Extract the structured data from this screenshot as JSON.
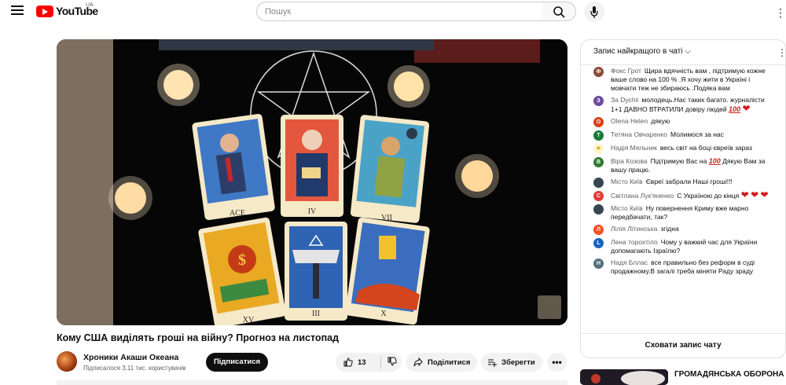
{
  "header": {
    "brand": "YouTube",
    "region": "UA",
    "search_placeholder": "Пошук"
  },
  "video": {
    "title": "Кому США виділять гроші на війну? Прогноз на листопад",
    "tarot_cards": [
      "ACE",
      "IV",
      "VII",
      "XV",
      "III",
      "X"
    ]
  },
  "channel": {
    "name": "Хроники Акаши Океана",
    "subscribers": "Підписалося 3,11 тис. користувачів",
    "subscribe_label": "Підписатися"
  },
  "actions": {
    "likes": "13",
    "share_label": "Поділитися",
    "save_label": "Зберегти"
  },
  "chat": {
    "header_label": "Запис найкращого в чаті",
    "hide_label": "Сховати запис чату",
    "messages": [
      {
        "author": "Фокс Грот",
        "text": "Щира вдячність вам , підтримую кожне ваше слово на 100 % .Я хочу жити в Україні і мовчати теж не збираюсь .Подяка вам",
        "avatar_letter": "Ф",
        "avatar_color": "#8d4d3a"
      },
      {
        "author": "За Dychii",
        "text": "молодець.Нас таких багато. журналісти 1+1 ДАВНО ВТРАТИЛИ довіру людей",
        "avatar_letter": "З",
        "avatar_color": "#6d4ca0"
      },
      {
        "author": "Olena Helen",
        "text": "дякую",
        "avatar_letter": "O",
        "avatar_color": "#d84315"
      },
      {
        "author": "Тетяна Овчаренко",
        "text": "Молимося за нас",
        "avatar_letter": "Т",
        "avatar_color": "#1b7a3a"
      },
      {
        "author": "Надія Мельник",
        "text": "весь світ на боці євреїв зараз",
        "avatar_letter": "Н",
        "avatar_color": "#f2b300"
      },
      {
        "author": "Віра Козова",
        "text": "Підтримую Вас на",
        "text_after": "Дякую Вам за вашу працю.",
        "avatar_letter": "В",
        "avatar_color": "#2e7d32"
      },
      {
        "author": "Місто Київ",
        "text": "Євреї забрали Наші гроші!!!",
        "avatar_letter": "М",
        "avatar_color": "#37474f"
      },
      {
        "author": "Світлана Лук'яненко",
        "text": "С Україною до кінця",
        "avatar_letter": "С",
        "avatar_color": "#e53935"
      },
      {
        "author": "Місто Київ",
        "text": "Ну повернення Криму вже марно передбачати, так?",
        "avatar_letter": "М",
        "avatar_color": "#37474f"
      },
      {
        "author": "Лілія Літинська",
        "text": "згідна",
        "avatar_letter": "Л",
        "avatar_color": "#f4511e"
      },
      {
        "author": "Лена торохтіло",
        "text": "Чому у важкий час для України допомагають Ізраїлю?",
        "avatar_letter": "L",
        "avatar_color": "#1565c0"
      },
      {
        "author": "Надя Бллас",
        "text": "все правильно без реформ в суді продажному.В загалі треба міняти Раду зраду",
        "avatar_letter": "Н",
        "avatar_color": "#546e7a"
      }
    ]
  },
  "recommendation": {
    "title": "ГРОМАДЯНСЬКА ОБОРОНА"
  }
}
